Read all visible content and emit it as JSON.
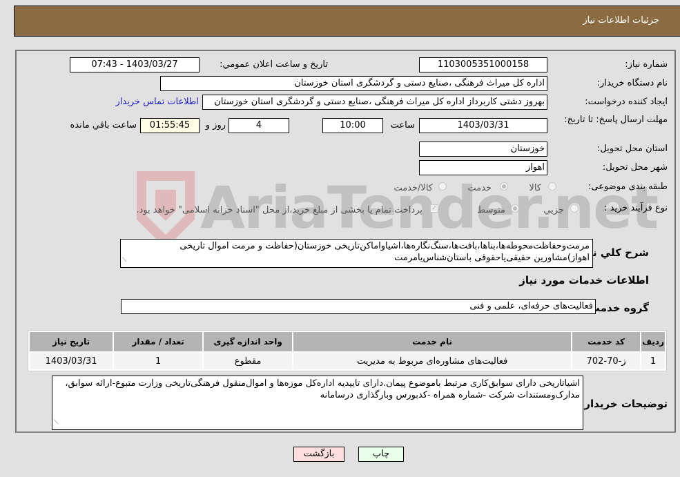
{
  "header": {
    "title": "جزئیات اطلاعات نیاز"
  },
  "form": {
    "need_number": {
      "label": "شماره نیاز:",
      "value": "1103005351000158"
    },
    "announce_datetime": {
      "label": "تاریخ و ساعت اعلان عمومي:",
      "value": "1403/03/27 - 07:43"
    },
    "buyer_org": {
      "label": "نام دستگاه خریدار:",
      "value": "اداره کل میراث فرهنگی ،صنایع دستی و گردشگری استان خوزستان"
    },
    "requester": {
      "label": "ایجاد کننده درخواست:",
      "value": "بهروز دشتی کاربرداز اداره کل میراث فرهنگی ،صنایع دستی و گردشگری استان خوزستان",
      "contact_link": "اطلاعات تماس خریدار"
    },
    "deadline": {
      "label": "مهلت ارسال پاسخ: تا تاریخ:",
      "date": "1403/03/31",
      "time_label": "ساعت",
      "time": "10:00",
      "days": "4",
      "days_label": "روز و",
      "remaining": "01:55:45",
      "remaining_label": "ساعت باقي مانده"
    },
    "province": {
      "label": "استان محل تحویل:",
      "value": "خوزستان"
    },
    "city": {
      "label": "شهر محل تحویل:",
      "value": "اهواز"
    },
    "category": {
      "label": "طبقه بندی موضوعی:",
      "options": [
        "کالا",
        "خدمت",
        "کالا/خدمت"
      ],
      "selected": "خدمت"
    },
    "purchase_type": {
      "label": "نوع فرآیند خرید :",
      "options": [
        "جزيي",
        "متوسط"
      ],
      "selected": "متوسط",
      "treasury_note": "پرداخت تمام یا بخشی از مبلغ خرید،از محل \"اسناد خزانه اسلامی\" خواهد بود.",
      "treasury_checked": true
    },
    "description": {
      "label": "شرح کلي نیاز:",
      "value": "مرمت‌وحفاظت‌محوطه‌ها،بناها،بافت‌ها،سنگ‌نگاره‌ها،اشیاواماکن‌تاریخی خوزستان(حفاظت و مرمت اموال تاریخی اهواز)مشاورین حقیقی‌یاحقوقی باستان‌شناس‌یامرمت"
    }
  },
  "services": {
    "section_title": "اطلاعات خدمات مورد نیاز",
    "group_label": "گروه خدمت:",
    "group_value": "فعالیت‌های حرفه‌ای، علمی و فنی",
    "columns": [
      "ردیف",
      "کد خدمت",
      "نام خدمت",
      "واحد اندازه گیری",
      "تعداد / مقدار",
      "تاریخ نیاز"
    ],
    "rows": [
      [
        "1",
        "ز-70-702",
        "فعالیت‌های مشاوره‌ای مربوط به مدیریت",
        "مقطوع",
        "1",
        "1403/03/31"
      ]
    ]
  },
  "buyer_notes": {
    "label": "توضیحات خریدار:",
    "value": "اشیاتاریخی دارای سوابق‌کاری مرتبط باموضوع پیمان.دارای تاییدیه اداره‌کل موزه‌ها و اموال‌منقول فرهنگی‌تاریخی وزارت متبوع-ارائه سوابق، مدارک‌ومستندات شرکت -شماره همراه -کدبورس وبارگذاری درسامانه"
  },
  "buttons": {
    "print": "چاپ",
    "back": "بازگشت"
  },
  "watermark": {
    "text": "AriaTender.net"
  },
  "colors": {
    "header_bg": "#8b6c42",
    "print_bg": "#eaffea",
    "back_bg": "#ffdede",
    "link": "#2020cc"
  }
}
